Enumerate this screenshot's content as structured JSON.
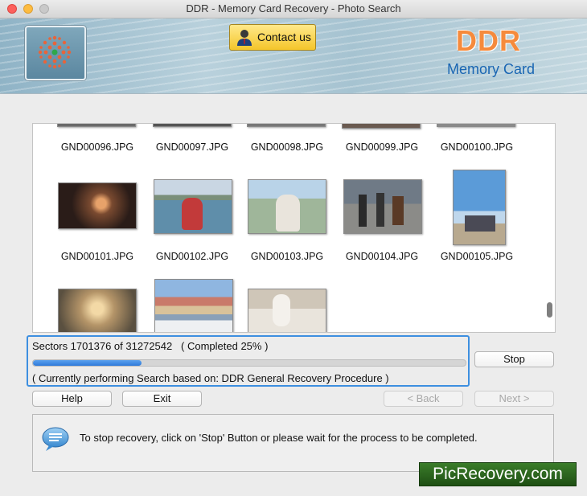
{
  "window": {
    "title": "DDR - Memory Card Recovery - Photo Search"
  },
  "header": {
    "contact_label": "Contact us",
    "brand": "DDR",
    "brand_sub": "Memory Card"
  },
  "gallery": {
    "row1": [
      "GND00096.JPG",
      "GND00097.JPG",
      "GND00098.JPG",
      "GND00099.JPG",
      "GND00100.JPG"
    ],
    "row2": [
      "GND00101.JPG",
      "GND00102.JPG",
      "GND00103.JPG",
      "GND00104.JPG",
      "GND00105.JPG"
    ]
  },
  "progress": {
    "sectors_text": "Sectors 1701376 of 31272542   ( Completed 25% )",
    "percent": 25,
    "procedure_text": "( Currently performing Search based on: DDR General Recovery Procedure )"
  },
  "buttons": {
    "stop": "Stop",
    "help": "Help",
    "exit": "Exit",
    "back": "< Back",
    "next": "Next >"
  },
  "info": {
    "message": "To stop recovery, click on 'Stop' Button or please wait for the process to be completed."
  },
  "watermark": "PicRecovery.com",
  "colors": {
    "accent": "#3d8fe0",
    "brand_orange": "#f58a3c",
    "brand_blue": "#1a66b3"
  }
}
